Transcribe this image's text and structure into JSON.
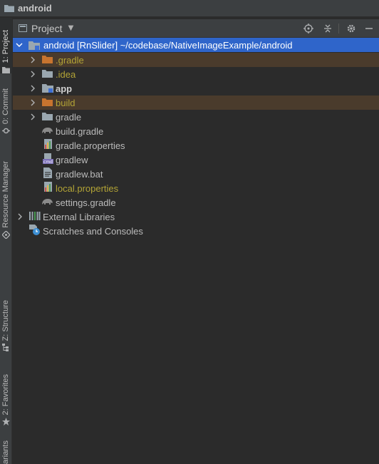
{
  "titlebar": {
    "crumb": "android",
    "icon": "folder-icon"
  },
  "left_strip": {
    "tabs": [
      {
        "label": "1: Project",
        "icon": "folder-icon"
      },
      {
        "label": "0: Commit",
        "icon": "commit-icon"
      },
      {
        "label": "Resource Manager",
        "icon": "resource-manager-icon"
      },
      {
        "label": "Z: Structure",
        "icon": "structure-icon"
      },
      {
        "label": "2: Favorites",
        "icon": "star-icon"
      },
      {
        "label": "ariants",
        "icon": ""
      }
    ]
  },
  "panel": {
    "title": "Project",
    "actions": [
      "locate-icon",
      "collapse-all-icon",
      "gear-icon",
      "minimize-icon"
    ]
  },
  "tree": {
    "root": {
      "name": "android",
      "module": "[RnSlider]",
      "path": "~/codebase/NativeImageExample/android"
    },
    "children": [
      {
        "label": ".gradle",
        "kind": "folder-excluded"
      },
      {
        "label": ".idea",
        "kind": "folder"
      },
      {
        "label": "app",
        "kind": "module"
      },
      {
        "label": "build",
        "kind": "folder-excluded"
      },
      {
        "label": "gradle",
        "kind": "folder"
      },
      {
        "label": "build.gradle",
        "kind": "gradle-file"
      },
      {
        "label": "gradle.properties",
        "kind": "properties-file"
      },
      {
        "label": "gradlew",
        "kind": "script-file"
      },
      {
        "label": "gradlew.bat",
        "kind": "text-file"
      },
      {
        "label": "local.properties",
        "kind": "properties-file-ignored"
      },
      {
        "label": "settings.gradle",
        "kind": "gradle-file"
      }
    ],
    "external_libraries": "External Libraries",
    "scratches": "Scratches and Consoles"
  },
  "colors": {
    "background": "#2b2b2b",
    "toolbar": "#3c3f41",
    "selection": "#2f65ca",
    "excluded_row": "#4a3b2c",
    "excluded_folder": "#c7742f",
    "ignored_text": "#b3a436",
    "folder": "#9aa7b0"
  }
}
